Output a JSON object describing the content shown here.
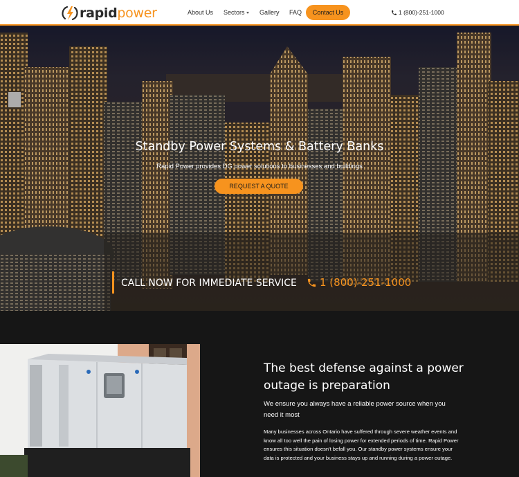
{
  "logo": {
    "text_main": "rapid",
    "text_accent": "power",
    "icon": "lightning-bolt-icon"
  },
  "nav": {
    "about": "About Us",
    "sectors": "Sectors",
    "gallery": "Gallery",
    "faq": "FAQ",
    "contact": "Contact Us",
    "phone": "1 (800)-251-1000",
    "phone_icon": "phone-icon"
  },
  "hero": {
    "title": "Standby Power Systems & Battery Banks",
    "subtitle": "Rapid Power provides DG power solutions to businesses and buildings",
    "cta_button": "REQUEST A QUOTE",
    "call_text": "CALL NOW FOR IMMEDIATE SERVICE",
    "call_phone": "1 (800)-251-1000"
  },
  "section": {
    "title": "The best defense against a power outage is preparation",
    "lead": "We ensure you always have a reliable power source when you need it most",
    "body": "Many businesses across Ontario have suffered through severe weather events and know all too well the pain of losing power for extended periods of time. Rapid Power ensures this situation doesn't befall you. Our standby power systems ensure your data is protected and your business stays up and running during a power outage."
  },
  "colors": {
    "accent": "#f7931e",
    "dark": "#161616",
    "text_dark": "#2b2b2b"
  }
}
